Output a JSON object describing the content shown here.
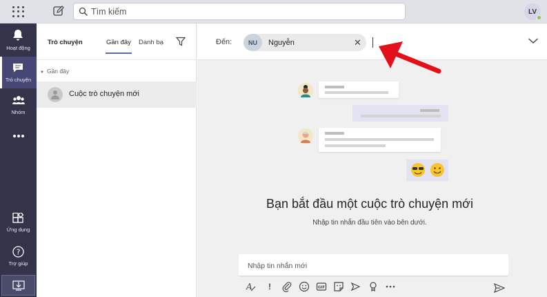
{
  "search": {
    "placeholder": "Tìm kiếm"
  },
  "user": {
    "initials": "LV"
  },
  "rail": {
    "items": [
      {
        "label": "Hoạt động",
        "icon": "bell-icon"
      },
      {
        "label": "Trò chuyện",
        "icon": "chat-icon",
        "active": true
      },
      {
        "label": "Nhóm",
        "icon": "teams-icon"
      },
      {
        "label": "",
        "icon": "more-icon"
      },
      {
        "label": "Ứng dụng",
        "icon": "apps-icon"
      },
      {
        "label": "Trợ giúp",
        "icon": "help-icon"
      }
    ]
  },
  "list": {
    "title": "Trò chuyện",
    "tabs": [
      "Gần đây",
      "Danh bạ"
    ],
    "section": "Gần đây",
    "new_chat": "Cuộc trò chuyện mới"
  },
  "to": {
    "label": "Đến:",
    "recipient_initials": "NU",
    "recipient_name": "Nguyễn"
  },
  "empty_state": {
    "headline": "Bạn bắt đầu một cuộc trò chuyện mới",
    "subline": "Nhập tin nhắn đầu tiên vào bên dưới."
  },
  "composer": {
    "placeholder": "Nhập tin nhắn mới"
  },
  "colors": {
    "rail_bg": "#33344a",
    "accent": "#6264a7",
    "arrow": "#e3101a"
  }
}
